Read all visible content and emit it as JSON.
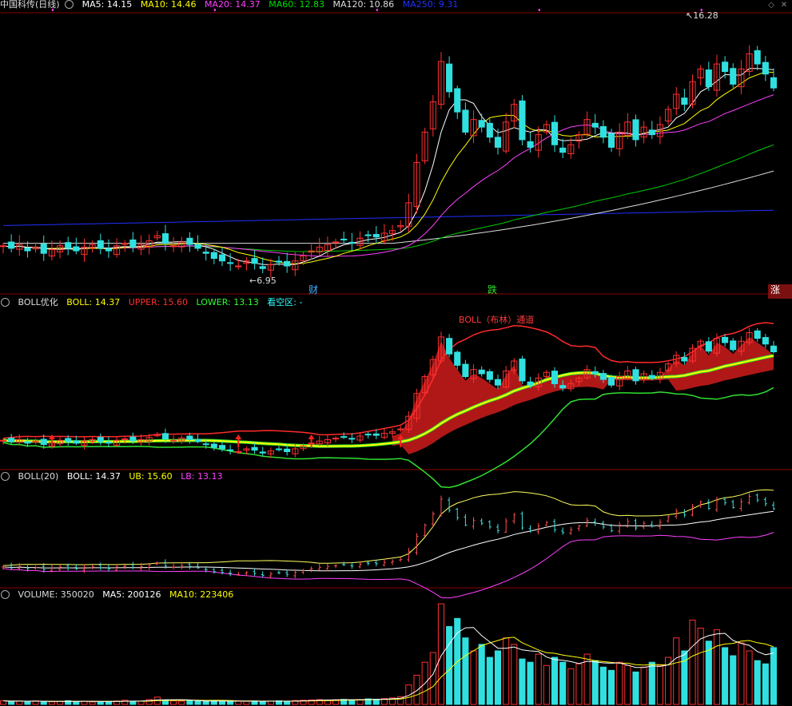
{
  "header": {
    "title": "中国科传(日线)",
    "ma": [
      {
        "label": "MA5: 14.15",
        "color": "#ffffff"
      },
      {
        "label": "MA10: 14.46",
        "color": "#ffff00"
      },
      {
        "label": "MA20: 14.37",
        "color": "#ff40ff"
      },
      {
        "label": "MA60: 12.83",
        "color": "#00dd00"
      },
      {
        "label": "MA120: 10.86",
        "color": "#dddddd"
      },
      {
        "label": "MA250: 9.31",
        "color": "#2030ff"
      }
    ],
    "high_label": "16.28",
    "low_label": "6.95",
    "markers": {
      "cai": "财",
      "die": "跌",
      "zhang": "涨"
    }
  },
  "panel2": {
    "name": "BOLL优化",
    "items": [
      {
        "label": "BOLL: 14.37",
        "color": "#ffff00"
      },
      {
        "label": "UPPER: 15.60",
        "color": "#ff3030"
      },
      {
        "label": "LOWER: 13.13",
        "color": "#30ff30"
      },
      {
        "label": "看空区: -",
        "color": "#30ffff"
      }
    ],
    "channel_title": "BOLL（布林）通道"
  },
  "panel3": {
    "name": "BOLL(20)",
    "items": [
      {
        "label": "BOLL: 14.37",
        "color": "#ffffff"
      },
      {
        "label": "UB: 15.60",
        "color": "#ffff00"
      },
      {
        "label": "LB: 13.13",
        "color": "#ff40ff"
      }
    ]
  },
  "panel4": {
    "name": "VOLUME: 350020",
    "items": [
      {
        "label": "MA5: 200126",
        "color": "#ffffff"
      },
      {
        "label": "MA10: 223406",
        "color": "#ffff00"
      }
    ]
  },
  "icons": [
    "indicator-dot-icon",
    "window-diamond-icon",
    "window-close-icon"
  ],
  "chart_data": {
    "type": "candlestick",
    "title": "中国科传(日线)",
    "y_high": 16.28,
    "y_low": 6.95,
    "closes": [
      7.9,
      7.8,
      7.95,
      7.7,
      7.85,
      7.6,
      7.75,
      7.9,
      7.8,
      7.7,
      7.85,
      7.95,
      7.8,
      7.7,
      7.9,
      8.0,
      7.85,
      7.95,
      8.1,
      8.3,
      8.0,
      7.9,
      8.05,
      7.95,
      7.8,
      7.6,
      7.4,
      7.3,
      7.2,
      7.1,
      7.3,
      7.2,
      7.0,
      7.15,
      7.25,
      7.1,
      7.3,
      7.5,
      7.7,
      7.85,
      7.95,
      8.05,
      8.15,
      8.0,
      8.2,
      8.3,
      8.25,
      8.4,
      8.5,
      8.7,
      9.6,
      11.2,
      12.4,
      13.6,
      15.2,
      14.0,
      13.2,
      12.4,
      12.9,
      12.6,
      12.2,
      11.8,
      12.8,
      13.5,
      12.1,
      11.8,
      12.3,
      12.7,
      11.9,
      11.6,
      11.9,
      12.3,
      12.9,
      12.6,
      12.2,
      11.8,
      12.4,
      12.8,
      12.1,
      12.6,
      12.3,
      12.7,
      13.3,
      13.9,
      13.5,
      14.4,
      14.9,
      14.2,
      15.1,
      14.8,
      14.3,
      14.9,
      15.5,
      15.1,
      14.7,
      14.15
    ],
    "volume": [
      22000,
      18000,
      20000,
      19000,
      21000,
      17000,
      16000,
      19000,
      23000,
      18000,
      20000,
      15000,
      17000,
      19000,
      21000,
      26000,
      18000,
      20000,
      30000,
      45000,
      28000,
      22000,
      20000,
      24000,
      21000,
      19000,
      23000,
      20000,
      18000,
      22000,
      19000,
      21000,
      17000,
      20000,
      22000,
      19000,
      24000,
      26000,
      28000,
      30000,
      27000,
      29000,
      31000,
      28000,
      30000,
      34000,
      32000,
      36000,
      40000,
      48000,
      120000,
      180000,
      260000,
      320000,
      620000,
      480000,
      530000,
      410000,
      330000,
      370000,
      290000,
      330000,
      410000,
      370000,
      280000,
      260000,
      310000,
      240000,
      290000,
      260000,
      220000,
      250000,
      310000,
      270000,
      230000,
      210000,
      260000,
      240000,
      200000,
      230000,
      260000,
      240000,
      290000,
      410000,
      330000,
      520000,
      470000,
      390000,
      460000,
      350000,
      300000,
      380000,
      330000,
      270000,
      250000,
      350020
    ],
    "series_last": {
      "MA5": 14.15,
      "MA10": 14.46,
      "MA20": 14.37,
      "MA60": 12.83,
      "MA120": 10.86,
      "MA250": 9.31,
      "BOLL": 14.37,
      "UPPER": 15.6,
      "LOWER": 13.13,
      "VOLUME": 350020,
      "VMA5": 200126,
      "VMA10": 223406
    },
    "ylim": [
      6.5,
      17.0
    ],
    "grid": false
  }
}
